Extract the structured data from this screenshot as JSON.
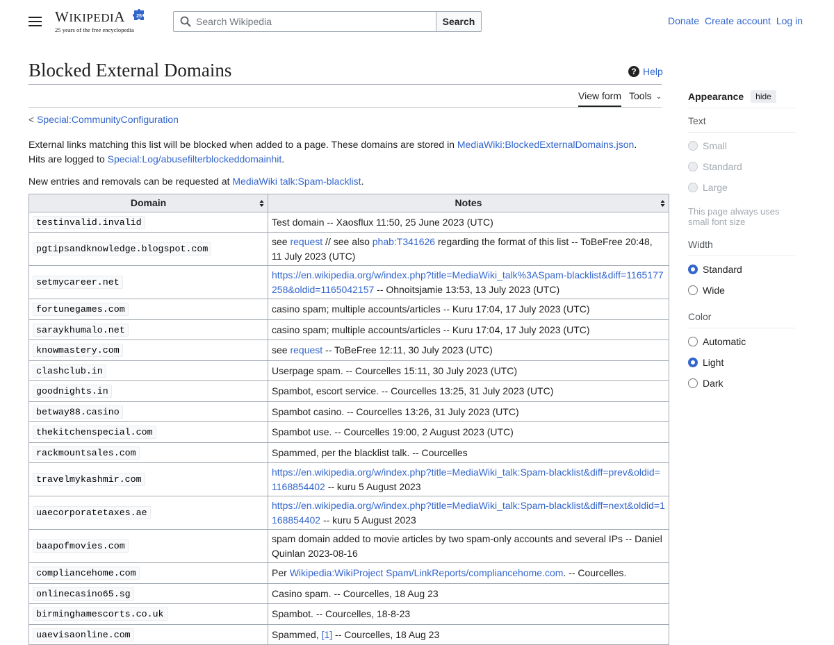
{
  "header": {
    "logo_wordmark": "Wikipedia",
    "logo_tagline": "25 years of the free encyclopedia",
    "search_placeholder": "Search Wikipedia",
    "search_button": "Search",
    "user_links": [
      "Donate",
      "Create account",
      "Log in"
    ]
  },
  "page": {
    "title": "Blocked External Domains",
    "help": "Help",
    "tabs": {
      "view_form": "View form",
      "tools": "Tools"
    },
    "backlink_prefix": "< ",
    "backlink": "Special:CommunityConfiguration",
    "intro": {
      "p1_a": "External links matching this list will be blocked when added to a page. These domains are stored in ",
      "p1_link1": "MediaWiki:BlockedExternalDomains.json",
      "p1_b": ". Hits are logged to ",
      "p1_link2": "Special:Log/abusefilterblockeddomainhit",
      "p1_c": ".",
      "p2_a": "New entries and removals can be requested at ",
      "p2_link": "MediaWiki talk:Spam-blacklist",
      "p2_b": "."
    }
  },
  "table": {
    "headers": [
      "Domain",
      "Notes"
    ],
    "rows": [
      {
        "domain": "testinvalid.invalid",
        "notes": [
          {
            "t": "Test domain -- Xaosflux 11:50, 25 June 2023 (UTC)"
          }
        ]
      },
      {
        "domain": "pgtipsandknowledge.blogspot.com",
        "notes": [
          {
            "t": "see "
          },
          {
            "l": "request"
          },
          {
            "t": " // see also "
          },
          {
            "l": "phab:T341626"
          },
          {
            "t": " regarding the format of this list -- ToBeFree 20:48, 11 July 2023 (UTC)"
          }
        ]
      },
      {
        "domain": "setmycareer.net",
        "notes": [
          {
            "l": "https://en.wikipedia.org/w/index.php?title=MediaWiki_talk%3ASpam-blacklist&diff=1165177258&oldid=1165042157"
          },
          {
            "t": " -- Ohnoitsjamie 13:53, 13 July 2023 (UTC)"
          }
        ]
      },
      {
        "domain": "fortunegames.com",
        "notes": [
          {
            "t": "casino spam; multiple accounts/articles -- Kuru 17:04, 17 July 2023 (UTC)"
          }
        ]
      },
      {
        "domain": "saraykhumalo.net",
        "notes": [
          {
            "t": "casino spam; multiple accounts/articles -- Kuru 17:04, 17 July 2023 (UTC)"
          }
        ]
      },
      {
        "domain": "knowmastery.com",
        "notes": [
          {
            "t": "see "
          },
          {
            "l": "request"
          },
          {
            "t": " -- ToBeFree 12:11, 30 July 2023 (UTC)"
          }
        ]
      },
      {
        "domain": "clashclub.in",
        "notes": [
          {
            "t": "Userpage spam. -- Courcelles 15:11, 30 July 2023 (UTC)"
          }
        ]
      },
      {
        "domain": "goodnights.in",
        "notes": [
          {
            "t": "Spambot, escort service. -- Courcelles 13:25, 31 July 2023 (UTC)"
          }
        ]
      },
      {
        "domain": "betway88.casino",
        "notes": [
          {
            "t": "Spambot casino. -- Courcelles 13:26, 31 July 2023 (UTC)"
          }
        ]
      },
      {
        "domain": "thekitchenspecial.com",
        "notes": [
          {
            "t": "Spambot use. -- Courcelles 19:00, 2 August 2023 (UTC)"
          }
        ]
      },
      {
        "domain": "rackmountsales.com",
        "notes": [
          {
            "t": "Spammed, per the blacklist talk. -- Courcelles"
          }
        ]
      },
      {
        "domain": "travelmykashmir.com",
        "notes": [
          {
            "l": "https://en.wikipedia.org/w/index.php?title=MediaWiki_talk:Spam-blacklist&diff=prev&oldid=1168854402"
          },
          {
            "t": " -- kuru 5 August 2023"
          }
        ]
      },
      {
        "domain": "uaecorporatetaxes.ae",
        "notes": [
          {
            "l": "https://en.wikipedia.org/w/index.php?title=MediaWiki_talk:Spam-blacklist&diff=next&oldid=1168854402"
          },
          {
            "t": " -- kuru 5 August 2023"
          }
        ]
      },
      {
        "domain": "baapofmovies.com",
        "notes": [
          {
            "t": "spam domain added to movie articles by two spam-only accounts and several IPs -- Daniel Quinlan 2023-08-16"
          }
        ]
      },
      {
        "domain": "compliancehome.com",
        "notes": [
          {
            "t": "Per "
          },
          {
            "l": "Wikipedia:WikiProject Spam/LinkReports/compliancehome.com"
          },
          {
            "t": ". -- Courcelles."
          }
        ]
      },
      {
        "domain": "onlinecasino65.sg",
        "notes": [
          {
            "t": "Casino spam. -- Courcelles, 18 Aug 23"
          }
        ]
      },
      {
        "domain": "birminghamescorts.co.uk",
        "notes": [
          {
            "t": "Spambot. -- Courcelles, 18-8-23"
          }
        ]
      },
      {
        "domain": "uaevisaonline.com",
        "notes": [
          {
            "t": "Spammed, "
          },
          {
            "l": "[1]"
          },
          {
            "t": " -- Courcelles, 18 Aug 23"
          }
        ]
      }
    ]
  },
  "appearance": {
    "title": "Appearance",
    "hide": "hide",
    "text": {
      "label": "Text",
      "options": [
        "Small",
        "Standard",
        "Large"
      ],
      "note": "This page always uses small font size"
    },
    "width": {
      "label": "Width",
      "options": [
        "Standard",
        "Wide"
      ],
      "selected": "Standard"
    },
    "color": {
      "label": "Color",
      "options": [
        "Automatic",
        "Light",
        "Dark"
      ],
      "selected": "Light"
    }
  }
}
